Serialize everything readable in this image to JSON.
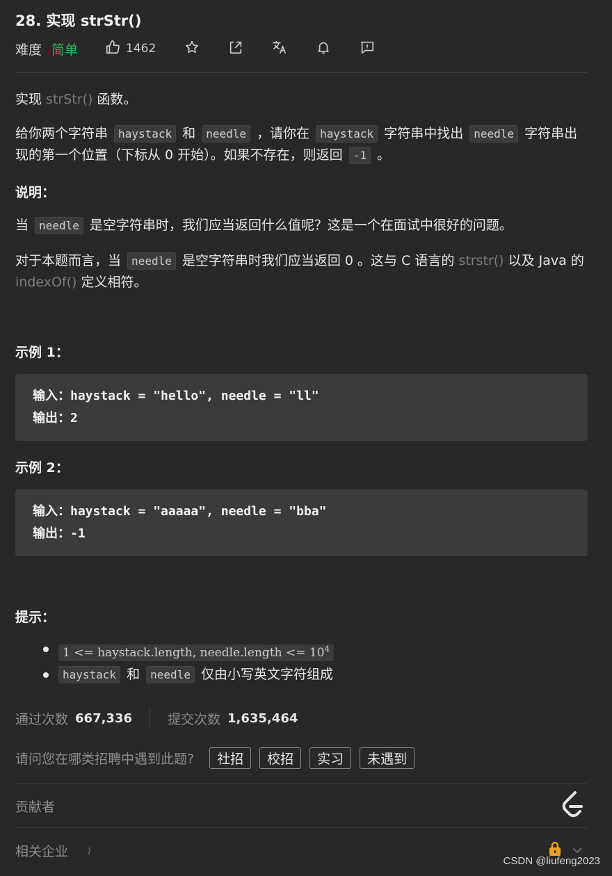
{
  "problem": {
    "title": "28. 实现 strStr()",
    "difficulty_label": "难度",
    "difficulty": "简单",
    "likes": "1462"
  },
  "icons": [
    "thumbs-up-icon",
    "star-icon",
    "share-icon",
    "translate-icon",
    "bell-icon",
    "feedback-icon",
    "leetcode-logo-icon",
    "lock-icon",
    "chevron-down-icon",
    "info-icon"
  ],
  "colors": {
    "easy_green": "#2db55d",
    "background": "#282828",
    "code_bg": "#3b3b3b",
    "lock_orange": "#f0a020"
  },
  "description": {
    "p1": {
      "a": "实现 ",
      "fn": "strStr()",
      "b": " 函数。"
    },
    "p2": {
      "a": "给你两个字符串 ",
      "c1": "haystack",
      "b": " 和 ",
      "c2": "needle",
      "c": " ，请你在 ",
      "c3": "haystack",
      "d": " 字符串中找出 ",
      "c4": "needle",
      "e": " 字符串出现的第一个位置（下标从 0 开始）。如果不存在，则返回 ",
      "c5": "-1",
      "f": " 。"
    },
    "note_heading": "说明：",
    "p3": {
      "a": "当 ",
      "c1": "needle",
      "b": " 是空字符串时，我们应当返回什么值呢？这是一个在面试中很好的问题。"
    },
    "p4": {
      "a": "对于本题而言，当 ",
      "c1": "needle",
      "b": " 是空字符串时我们应当返回 0 。这与 C 语言的 ",
      "fn1": "strstr()",
      "c": " 以及 Java 的 ",
      "fn2": "indexOf()",
      "d": " 定义相符。"
    }
  },
  "examples": [
    {
      "heading": "示例 1：",
      "input": "输入：haystack = \"hello\", needle = \"ll\"",
      "output": "输出：2"
    },
    {
      "heading": "示例 2：",
      "input": "输入：haystack = \"aaaaa\", needle = \"bba\"",
      "output": "输出：-1"
    }
  ],
  "hints": {
    "heading": "提示：",
    "h1_main": "1 <= haystack.length, needle.length <= 10",
    "h1_sup": "4",
    "h2": {
      "c1": "haystack",
      "a": " 和 ",
      "c2": "needle",
      "b": " 仅由小写英文字符组成"
    }
  },
  "stats": {
    "accepted_label": "通过次数",
    "accepted": "667,336",
    "submitted_label": "提交次数",
    "submitted": "1,635,464"
  },
  "recruit": {
    "question": "请问您在哪类招聘中遇到此题?",
    "tags": [
      "社招",
      "校招",
      "实习",
      "未遇到"
    ]
  },
  "contributors_label": "贡献者",
  "companies_label": "相关企业",
  "watermark": "CSDN @liufeng2023"
}
